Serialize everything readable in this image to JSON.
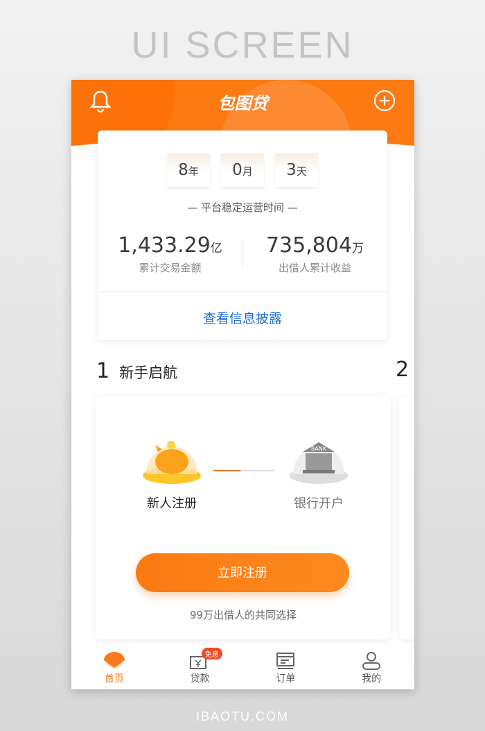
{
  "screen_title": "UI SCREEN",
  "footer": "IBAOTU.COM",
  "header": {
    "title": "包图贷",
    "bell_icon": "bell-icon",
    "add_icon": "plus-circle-icon"
  },
  "stats": {
    "duration": [
      {
        "num": "8",
        "unit": "年"
      },
      {
        "num": "0",
        "unit": "月"
      },
      {
        "num": "3",
        "unit": "天"
      }
    ],
    "subtitle": "— 平台稳定运营时间 —",
    "items": [
      {
        "value": "1,433.29",
        "unit": "亿",
        "label": "累计交易金额"
      },
      {
        "value": "735,804",
        "unit": "万",
        "label": "出借人累计收益"
      }
    ],
    "link": "查看信息披露"
  },
  "section": {
    "num": "1",
    "title": "新手启航",
    "next_num": "2"
  },
  "steps": [
    {
      "label": "新人注册",
      "icon": "piggy-bank-icon"
    },
    {
      "label": "银行开户",
      "icon": "bank-icon",
      "icon_text": "BANK"
    }
  ],
  "register_button": "立即注册",
  "note": "99万出借人的共同选择",
  "tabs": [
    {
      "label": "首页",
      "active": true
    },
    {
      "label": "贷款",
      "badge": "免息"
    },
    {
      "label": "订单"
    },
    {
      "label": "我的"
    }
  ],
  "colors": {
    "accent": "#fb7a12",
    "link": "#1b6ed6",
    "badge": "#f04a23"
  }
}
